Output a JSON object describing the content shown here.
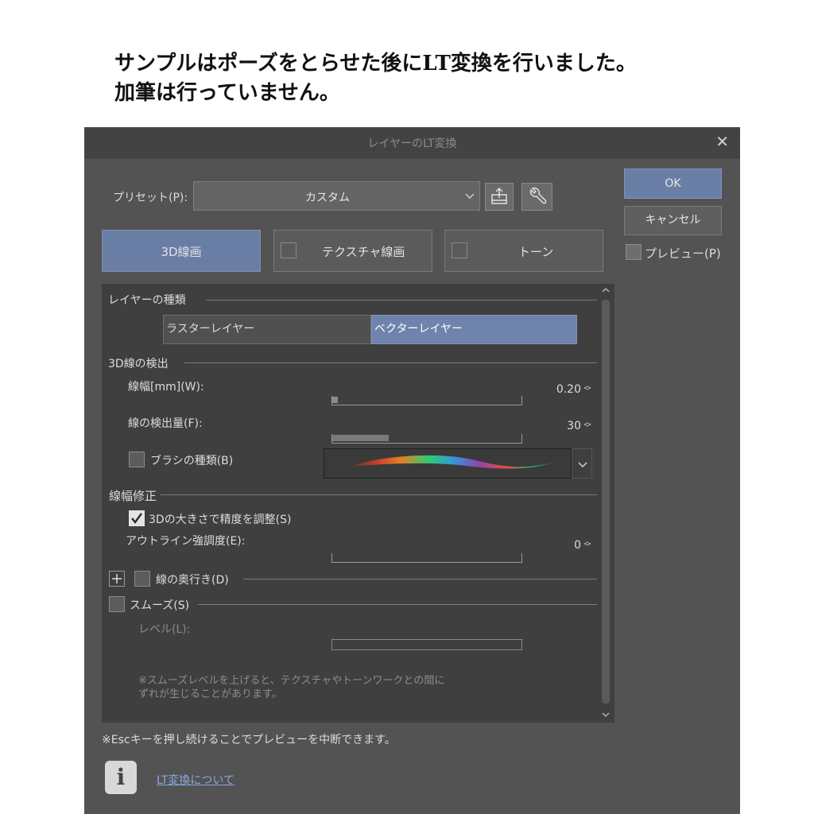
{
  "caption": {
    "line1": "サンプルはポーズをとらせた後にLT変換を行いました。",
    "line2": "加筆は行っていません。"
  },
  "dialog": {
    "title": "レイヤーのLT変換",
    "close_icon": "close-icon",
    "preset": {
      "label": "プリセット(P):",
      "value": "カスタム",
      "save_icon": "save-preset-icon",
      "settings_icon": "wrench-icon"
    },
    "buttons": {
      "ok": "OK",
      "cancel": "キャンセル",
      "preview": "プレビュー(P)",
      "preview_checked": false
    },
    "tabs": [
      {
        "label": "3D線画",
        "active": true
      },
      {
        "label": "テクスチャ線画",
        "active": false,
        "checked": false
      },
      {
        "label": "トーン",
        "active": false,
        "checked": false
      }
    ],
    "layer_type": {
      "heading": "レイヤーの種類",
      "options": [
        "ラスターレイヤー",
        "ベクターレイヤー"
      ],
      "selected": "ベクターレイヤー"
    },
    "detection": {
      "heading": "3D線の検出",
      "line_width": {
        "label": "線幅[mm](W):",
        "value": "0.20",
        "fraction": 0.03
      },
      "detect_amount": {
        "label": "線の検出量(F):",
        "value": "30",
        "fraction": 0.3
      },
      "brush": {
        "label": "ブラシの種類(B)",
        "checked": false
      }
    },
    "correction": {
      "heading": "線幅修正",
      "adjust_3d": {
        "label": "3Dの大きさで精度を調整(S)",
        "checked": true
      },
      "outline_emphasis": {
        "label": "アウトライン強調度(E):",
        "value": "0",
        "fraction": 0
      }
    },
    "depth": {
      "label": "線の奥行き(D)",
      "checked": false
    },
    "smooth": {
      "label": "スムーズ(S)",
      "checked": false,
      "level_label": "レベル(L):",
      "note_line1": "※スムーズレベルを上げると、テクスチャやトーンワークとの間に",
      "note_line2": "ずれが生じることがあります。"
    },
    "footer": {
      "esc_note": "※Escキーを押し続けることでプレビューを中断できます。",
      "info_icon": "info-icon",
      "link": "LT変換について"
    }
  }
}
